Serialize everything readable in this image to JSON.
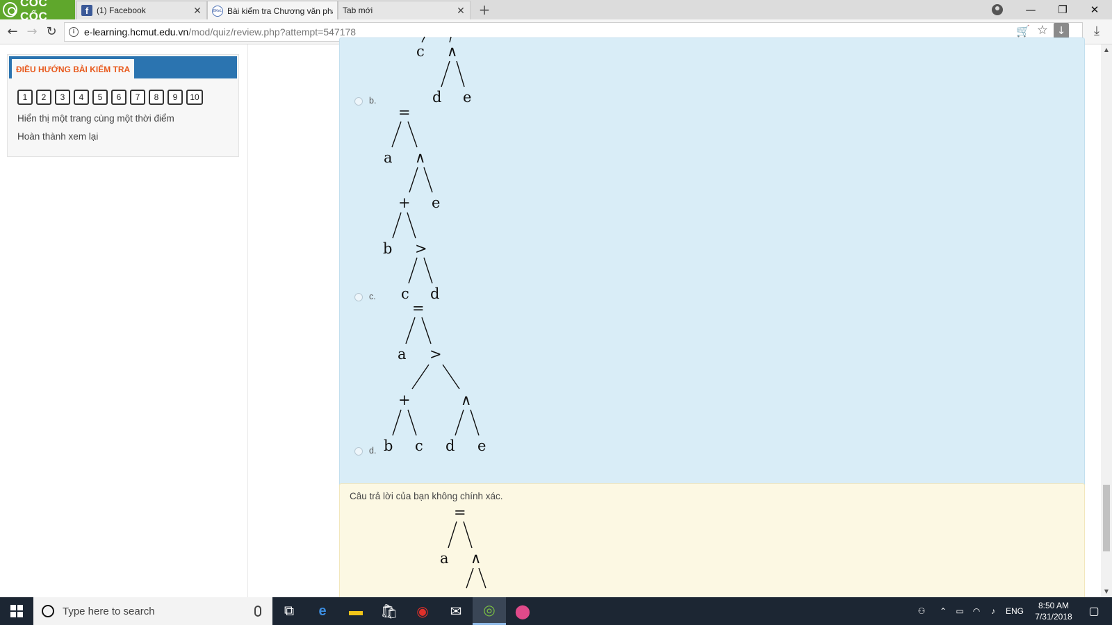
{
  "browser": {
    "brand": "CỐC CỐC",
    "tabs": [
      {
        "title": "(1) Facebook",
        "active": false
      },
      {
        "title": "Bài kiểm tra Chương văn phạm",
        "active": true
      },
      {
        "title": "Tab mới",
        "active": false
      }
    ],
    "favicon_bk": "BKeL",
    "url_host": "e-learning.hcmut.edu.vn",
    "url_path": "/mod/quiz/review.php?attempt=547178"
  },
  "sidebar": {
    "heading": "ĐIỀU HƯỚNG BÀI KIỂM TRA",
    "question_numbers": [
      "1",
      "2",
      "3",
      "4",
      "5",
      "6",
      "7",
      "8",
      "9",
      "10"
    ],
    "show_one_page": "Hiển thị một trang cùng một thời điểm",
    "finish_review": "Hoàn thành xem lại"
  },
  "question": {
    "options": [
      {
        "letter": "b."
      },
      {
        "letter": "c."
      },
      {
        "letter": "d."
      }
    ],
    "tree_b_partial": {
      "nodes": [
        "c",
        "∧",
        "d",
        "e"
      ]
    },
    "tree_c": {
      "nodes": [
        "=",
        "a",
        "∧",
        "+",
        "e",
        "b",
        ">",
        "c",
        "d"
      ]
    },
    "tree_d": {
      "nodes": [
        "=",
        "a",
        ">",
        "+",
        "∧",
        "b",
        "c",
        "d",
        "e"
      ]
    }
  },
  "feedback": {
    "text": "Câu trả lời của bạn không chính xác.",
    "tree_partial": {
      "nodes": [
        "=",
        "a",
        "∧"
      ]
    }
  },
  "taskbar": {
    "search_placeholder": "Type here to search",
    "language": "ENG",
    "time": "8:50 AM",
    "date": "7/31/2018"
  },
  "colors": {
    "brand_green": "#5fa72c",
    "sidebar_header_blue": "#2b74b0",
    "sidebar_heading_orange": "#e8591c",
    "answer_bg": "#d9edf7",
    "feedback_bg": "#fcf8e3",
    "taskbar_bg": "#1c2633"
  }
}
